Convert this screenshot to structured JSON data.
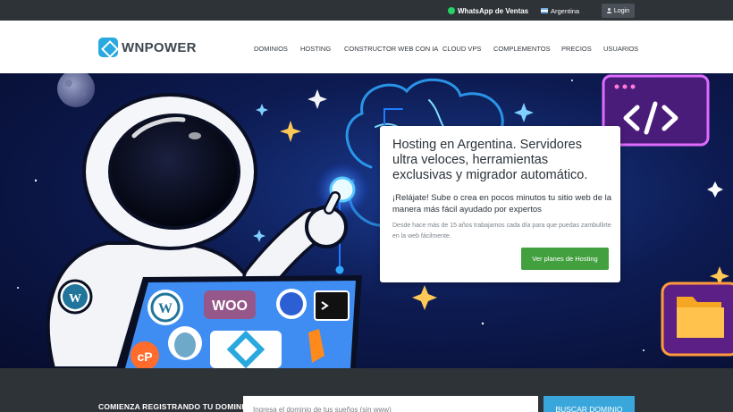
{
  "topbar": {
    "whatsapp_label": "WhatsApp de Ventas",
    "country_label": "Argentina",
    "login_label": "Login"
  },
  "header": {
    "logo_text": "WNPOWER",
    "nav": [
      {
        "label": "DOMINIOS"
      },
      {
        "label": "HOSTING"
      },
      {
        "label": "CONSTRUCTOR WEB CON IA"
      },
      {
        "label": "CLOUD VPS"
      },
      {
        "label": "COMPLEMENTOS"
      },
      {
        "label": "PRECIOS"
      },
      {
        "label": "USUARIOS"
      }
    ]
  },
  "hero": {
    "title": "Hosting en Argentina. Servidores ultra veloces, herramientas exclusivas y migrador automático.",
    "subtitle": "¡Relájate! Sube o crea en pocos minutos tu sitio web de la manera más fácil ayudado por expertos",
    "description": "Desde hace más de 15 años trabajamos cada día para que puedas zambullirte en la web fácilmente.",
    "cta_label": "Ver planes de Hosting",
    "illustration_badges": {
      "woo": "WOO",
      "cpanel": "cP"
    }
  },
  "domain_search": {
    "label": "COMIENZA REGISTRANDO TU DOMINIO",
    "placeholder": "Ingresa el dominio de tus sueños (sin www)",
    "button_label": "BUSCAR DOMINIO"
  },
  "colors": {
    "accent_blue": "#3aa7dc",
    "cta_green": "#43a03f",
    "dark_bar": "#2e3338"
  }
}
